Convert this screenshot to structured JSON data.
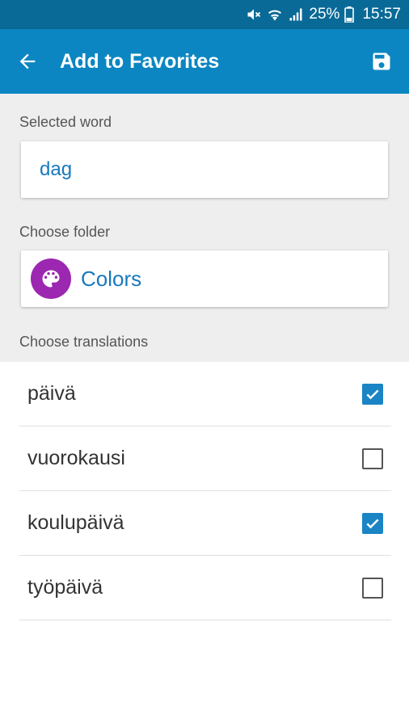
{
  "status_bar": {
    "battery_percent": "25%",
    "time": "15:57",
    "icons": [
      "mute-icon",
      "wifi-icon",
      "signal-icon",
      "battery-icon"
    ]
  },
  "app_bar": {
    "title": "Add to Favorites",
    "back_icon": "arrow-back-icon",
    "save_icon": "save-icon",
    "color": "#0b86c2"
  },
  "selected_word": {
    "label": "Selected word",
    "value": "dag"
  },
  "folder": {
    "label": "Choose folder",
    "name": "Colors",
    "icon": "palette-icon",
    "color": "#9c27b0"
  },
  "translations": {
    "label": "Choose translations",
    "items": [
      {
        "text": "päivä",
        "checked": true
      },
      {
        "text": "vuorokausi",
        "checked": false
      },
      {
        "text": "koulupäivä",
        "checked": true
      },
      {
        "text": "työpäivä",
        "checked": false
      }
    ]
  }
}
